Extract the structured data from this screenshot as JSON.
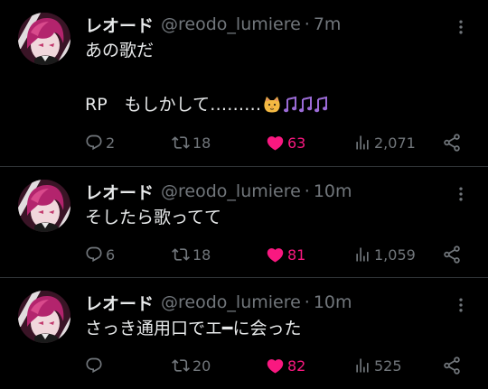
{
  "colors": {
    "background": "#000000",
    "text": "#e7e9ea",
    "muted": "#71767b",
    "like": "#f91880",
    "divider": "#2f3336"
  },
  "tweets": [
    {
      "display_name": "レオード",
      "handle": "@reodo_lumiere",
      "separator": "·",
      "time": "7m",
      "text": "あの歌だ",
      "text_line2": "RP　もしかして………",
      "emoji": [
        "cat-face-icon",
        "musical-notes-icon",
        "musical-notes-icon",
        "musical-notes-icon"
      ],
      "replies": "2",
      "retweets": "18",
      "likes": "63",
      "views": "2,071",
      "liked": true
    },
    {
      "display_name": "レオード",
      "handle": "@reodo_lumiere",
      "separator": "·",
      "time": "10m",
      "text": "そしたら歌ってて",
      "replies": "6",
      "retweets": "18",
      "likes": "81",
      "views": "1,059",
      "liked": true
    },
    {
      "display_name": "レオード",
      "handle": "@reodo_lumiere",
      "separator": "·",
      "time": "10m",
      "text": "さっき通用口でエ━に会った",
      "replies": "",
      "retweets": "20",
      "likes": "82",
      "views": "525",
      "liked": true
    }
  ]
}
